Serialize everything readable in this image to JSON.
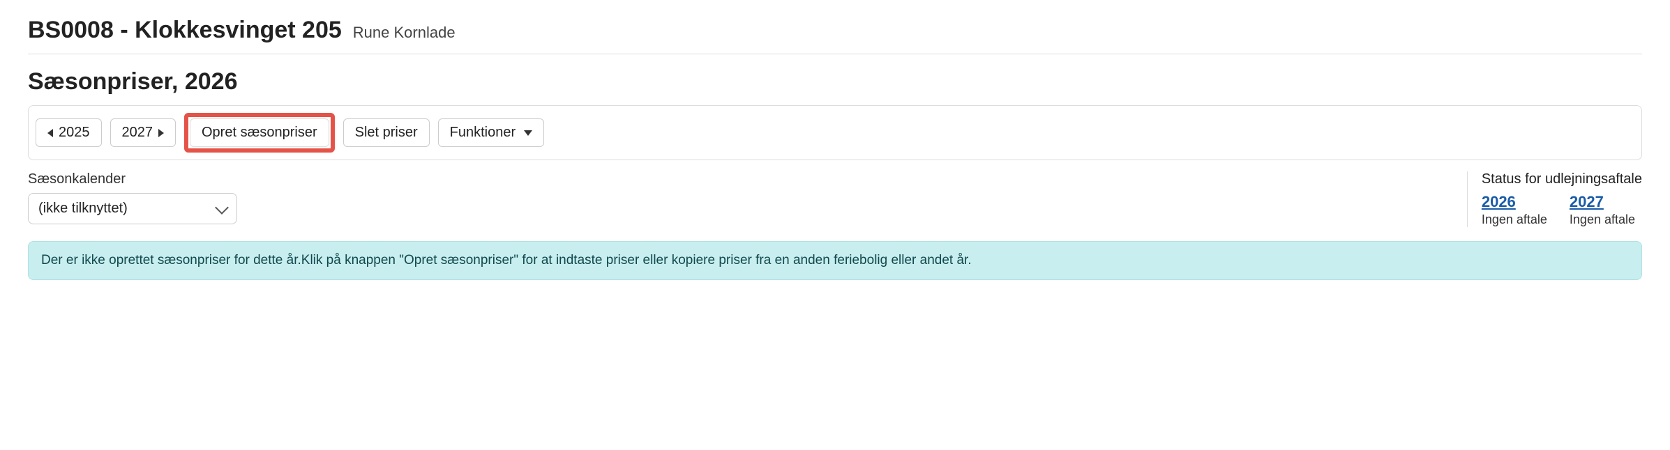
{
  "header": {
    "title": "BS0008 - Klokkesvinget 205",
    "subtitle": "Rune Kornlade"
  },
  "page": {
    "title": "Sæsonpriser, 2026"
  },
  "toolbar": {
    "prev_year": "2025",
    "next_year": "2027",
    "create": "Opret sæsonpriser",
    "delete": "Slet priser",
    "functions": "Funktioner"
  },
  "season_calendar": {
    "label": "Sæsonkalender",
    "selected": "(ikke tilknyttet)"
  },
  "status": {
    "title": "Status for udlejningsaftale",
    "years": [
      {
        "year": "2026",
        "text": "Ingen aftale"
      },
      {
        "year": "2027",
        "text": "Ingen aftale"
      }
    ]
  },
  "banner": {
    "text": "Der er ikke oprettet sæsonpriser for dette år.Klik på knappen \"Opret sæsonpriser\" for at indtaste priser eller kopiere priser fra en anden feriebolig eller andet år."
  }
}
